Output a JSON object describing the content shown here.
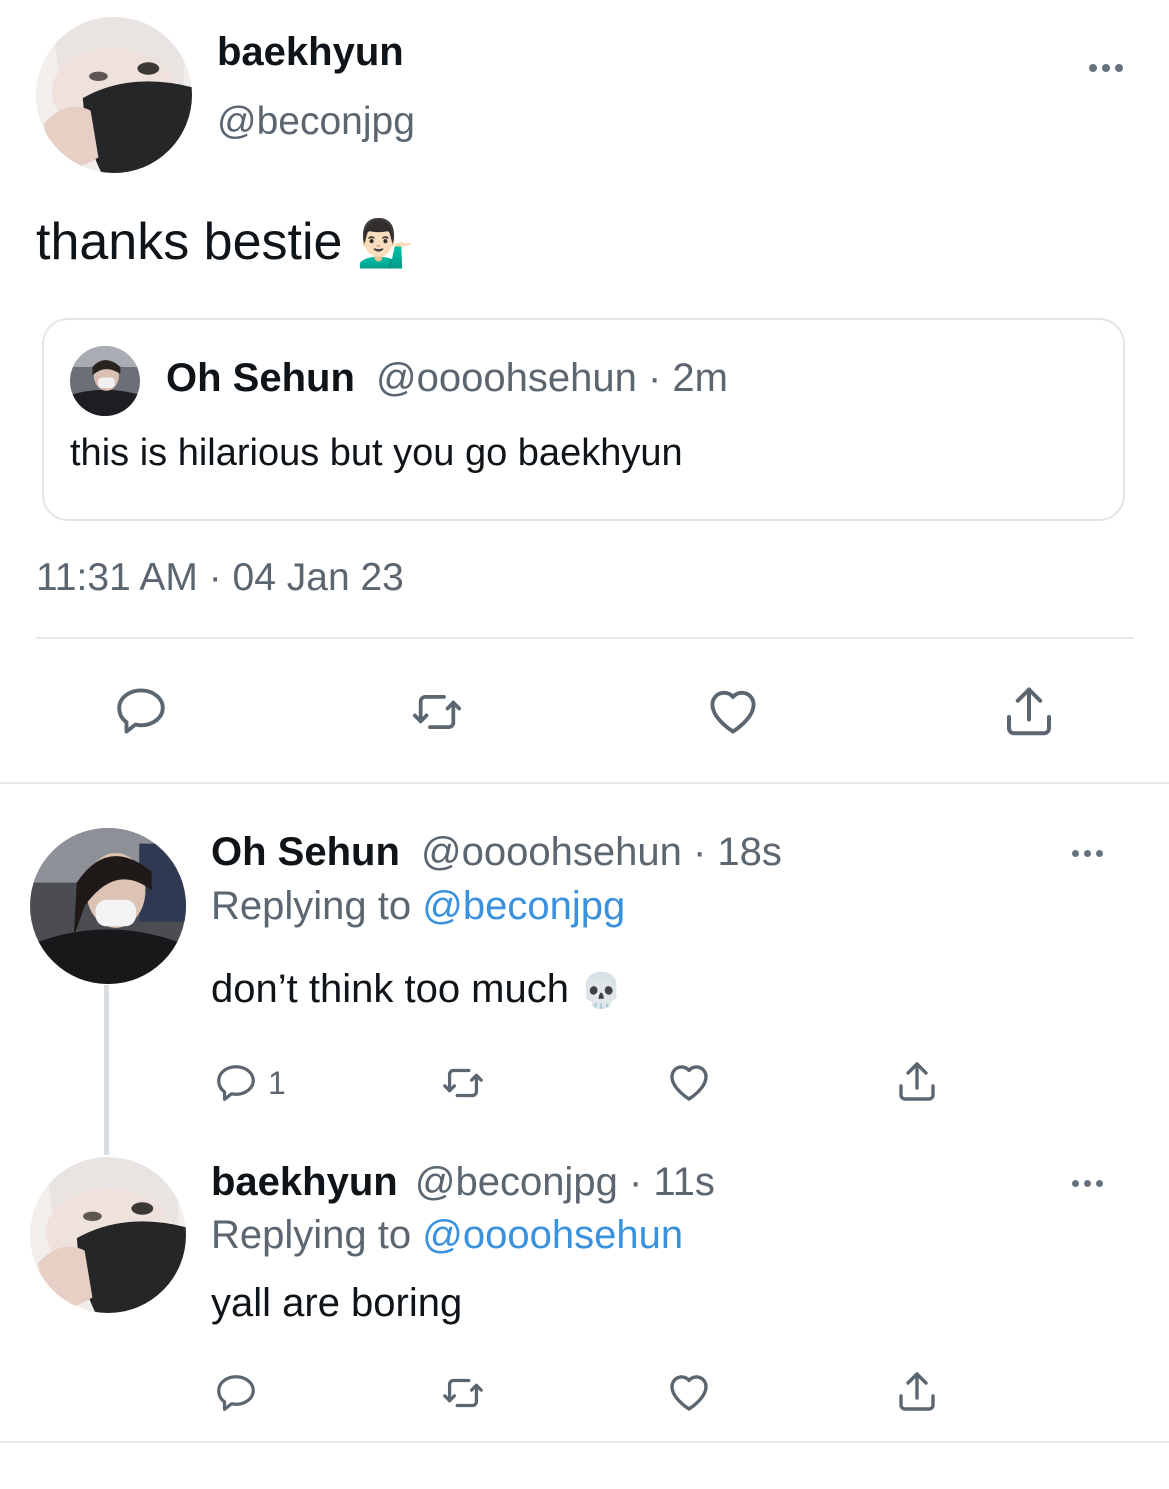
{
  "main_tweet": {
    "display_name": "baekhyun",
    "handle": "@beconjpg",
    "text": "thanks bestie",
    "emoji": "💁🏻‍♂️",
    "timestamp": "11:31 AM · 04 Jan 23",
    "quoted": {
      "display_name": "Oh Sehun",
      "handle": "@oooohsehun",
      "time": "· 2m",
      "text": "this is hilarious but you go baekhyun"
    }
  },
  "replies": [
    {
      "display_name": "Oh Sehun",
      "handle": "@oooohsehun",
      "time": "· 18s",
      "replying_prefix": "Replying to",
      "replying_to": "@beconjpg",
      "text": "don’t think too much",
      "emoji": "💀",
      "reply_count": "1"
    },
    {
      "display_name": "baekhyun",
      "handle": "@beconjpg",
      "time": "· 11s",
      "replying_prefix": "Replying to",
      "replying_to": "@oooohsehun",
      "text": "yall are boring",
      "reply_count": ""
    }
  ],
  "icons": {
    "reply": "reply-bubble-icon",
    "retweet": "retweet-icon",
    "like": "heart-icon",
    "share": "share-upload-icon",
    "more": "more-dots-icon"
  },
  "colors": {
    "text": "#0f1419",
    "secondary": "#5b6670",
    "link": "#3a91de",
    "icon": "#5b6670",
    "border": "#e1e6ea"
  }
}
